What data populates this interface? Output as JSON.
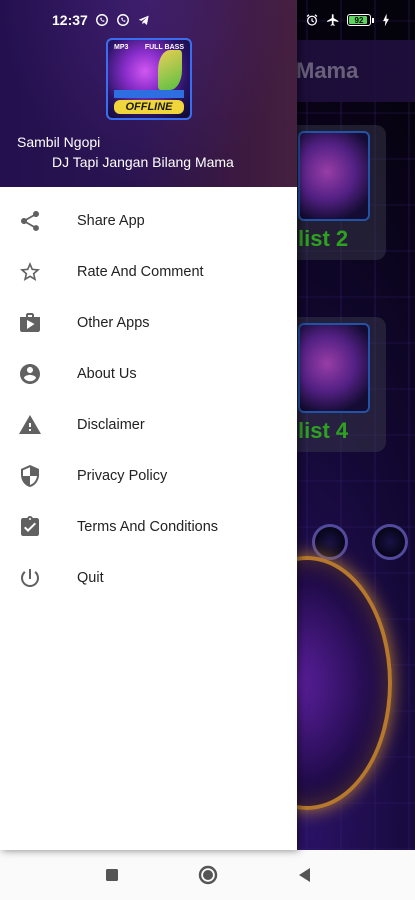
{
  "status_bar": {
    "time": "12:37",
    "battery_level": "92",
    "left_icons": [
      "whatsapp-icon",
      "whatsapp-icon",
      "telegram-icon"
    ],
    "right_icons": [
      "alarm-icon",
      "airplane-mode-icon",
      "battery-icon",
      "charging-icon"
    ]
  },
  "background_app": {
    "title_fragment": "Mama",
    "card_labels": [
      "list 2",
      "list 4"
    ]
  },
  "drawer": {
    "header": {
      "logo_top_left": "MP3",
      "logo_top_right": "FULL BASS",
      "logo_offline": "OFFLINE",
      "line1": "Sambil Ngopi",
      "line2": "DJ Tapi Jangan Bilang Mama"
    },
    "items": [
      {
        "label": "Share App",
        "icon": "share-icon"
      },
      {
        "label": "Rate And Comment",
        "icon": "star-icon"
      },
      {
        "label": "Other Apps",
        "icon": "shop-icon"
      },
      {
        "label": "About Us",
        "icon": "account-circle-icon"
      },
      {
        "label": "Disclaimer",
        "icon": "warning-icon"
      },
      {
        "label": "Privacy Policy",
        "icon": "shield-icon"
      },
      {
        "label": "Terms And Conditions",
        "icon": "clipboard-check-icon"
      },
      {
        "label": "Quit",
        "icon": "power-icon"
      }
    ]
  },
  "colors": {
    "drawer_background": "#ffffff",
    "icon_color": "#616161",
    "accent_green": "#3dcf2a"
  },
  "nav_bar": {
    "buttons": [
      "recents-button",
      "home-button",
      "back-button"
    ]
  }
}
